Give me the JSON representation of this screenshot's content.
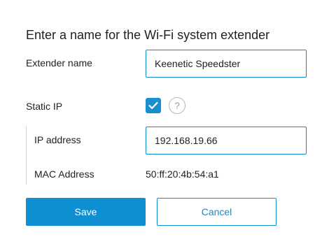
{
  "dialog": {
    "title": "Enter a name for the Wi-Fi system extender",
    "extender_name": {
      "label": "Extender name",
      "value": "Keenetic Speedster"
    },
    "static_ip": {
      "label": "Static IP",
      "checked": true,
      "help_glyph": "?"
    },
    "ip_address": {
      "label": "IP address",
      "value": "192.168.19.66"
    },
    "mac_address": {
      "label": "MAC Address",
      "value": "50:ff:20:4b:54:a1"
    },
    "buttons": {
      "save": "Save",
      "cancel": "Cancel"
    }
  },
  "colors": {
    "accent": "#0d8fd2",
    "input_border": "#0e8ccf",
    "text": "#222222",
    "help_icon": "#a0a0a0",
    "divider": "#d6d6d6"
  },
  "icons": {
    "checkbox": "checkmark-icon",
    "help": "question-circle-icon"
  }
}
